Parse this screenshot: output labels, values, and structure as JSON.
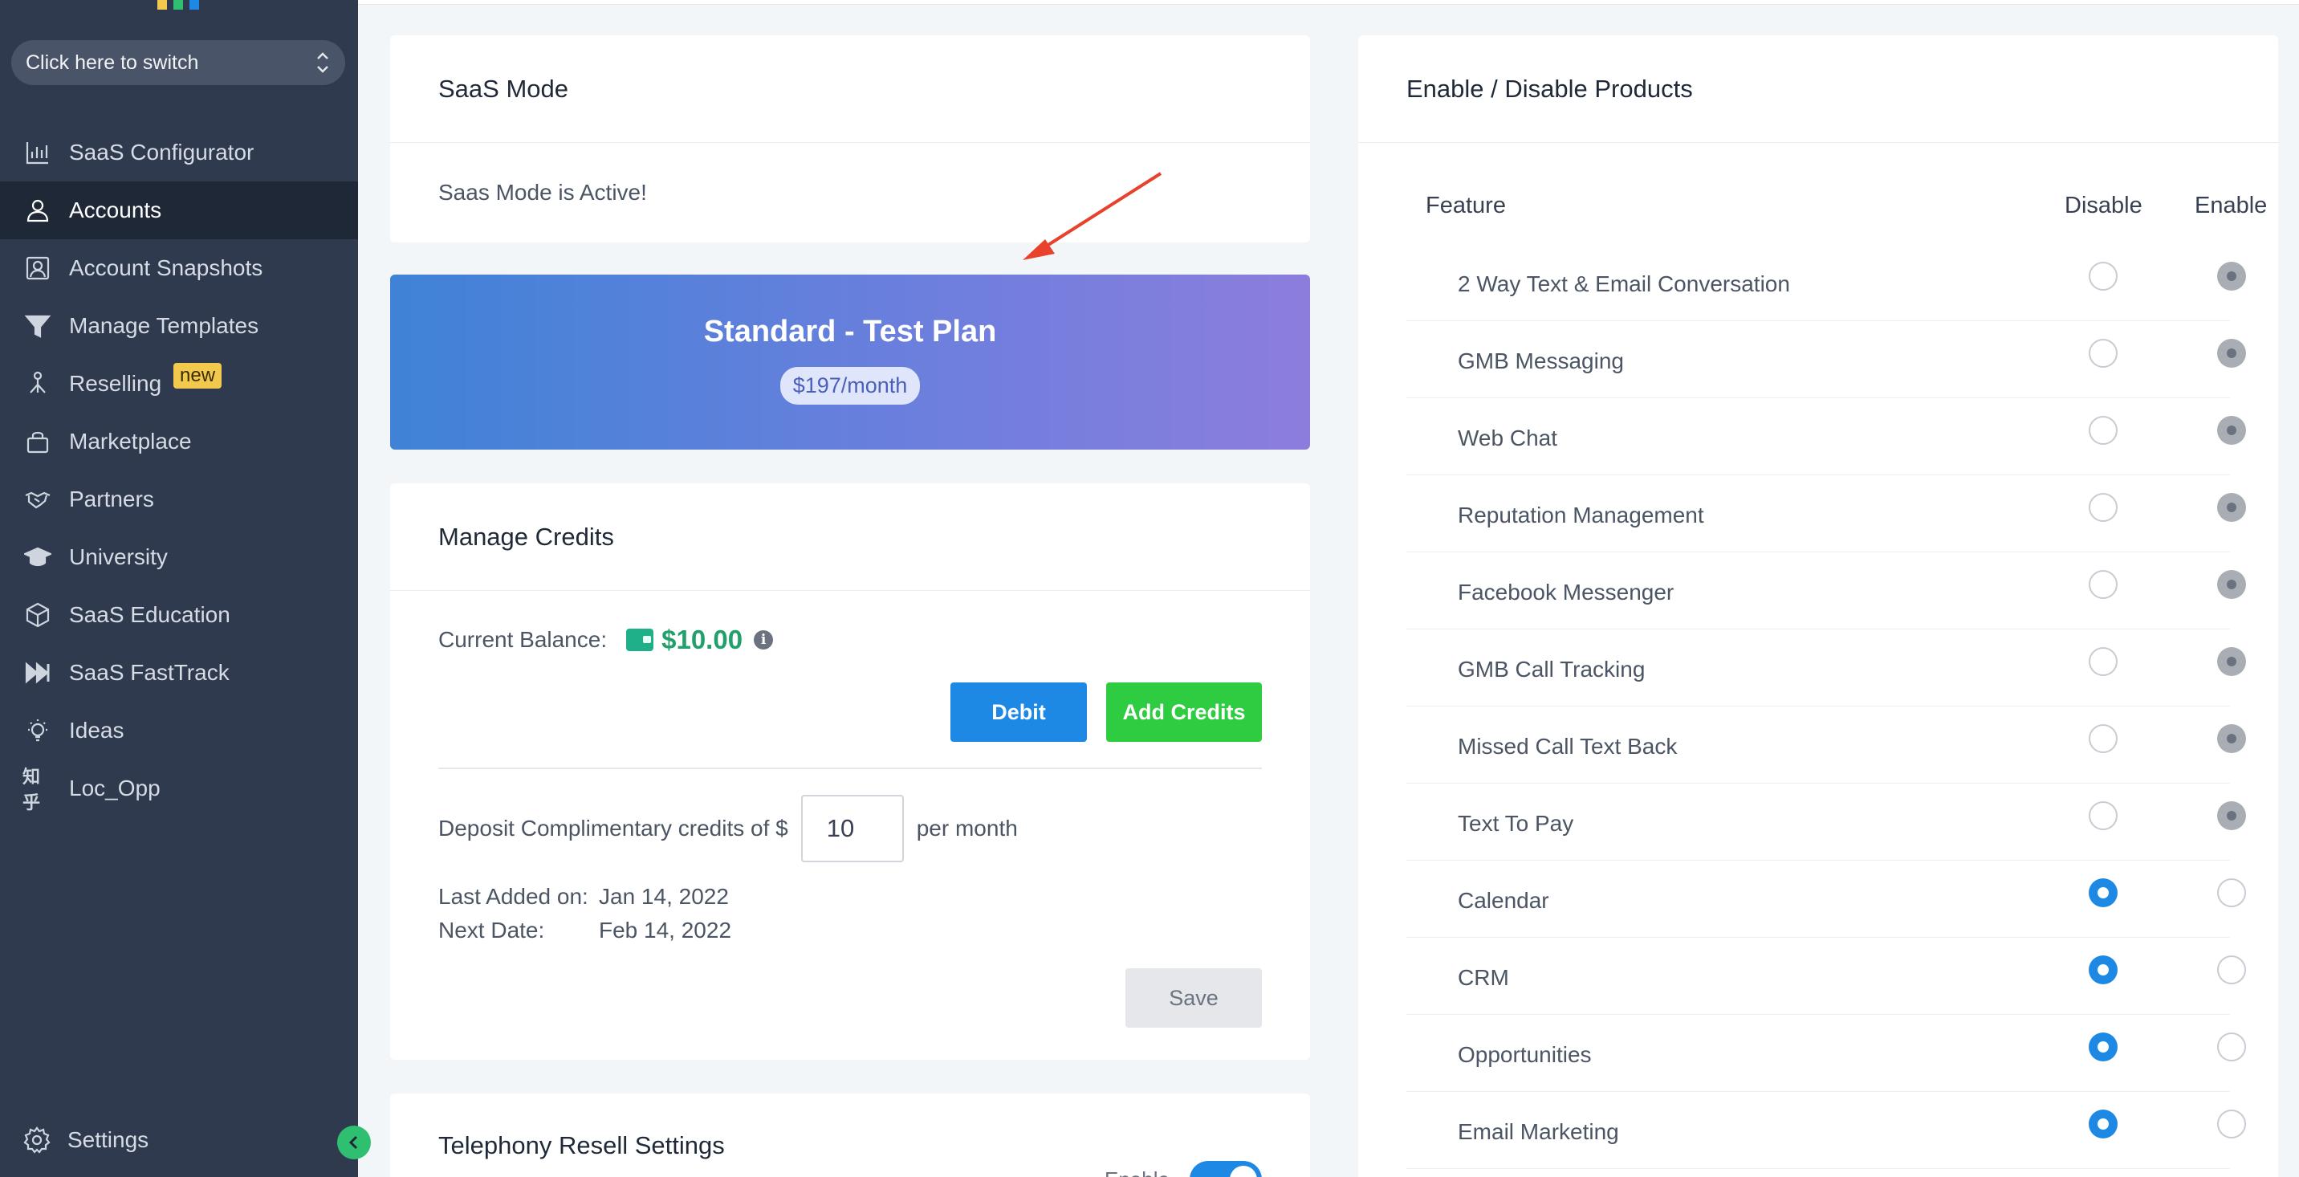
{
  "sidebar": {
    "switcher_label": "Click here to switch",
    "items": [
      {
        "label": "SaaS Configurator",
        "icon": "bar-chart-icon"
      },
      {
        "label": "Accounts",
        "icon": "user-icon",
        "active": true
      },
      {
        "label": "Account Snapshots",
        "icon": "snapshot-icon"
      },
      {
        "label": "Manage Templates",
        "icon": "filter-icon"
      },
      {
        "label": "Reselling",
        "icon": "network-icon",
        "badge": "new"
      },
      {
        "label": "Marketplace",
        "icon": "bag-icon"
      },
      {
        "label": "Partners",
        "icon": "handshake-icon"
      },
      {
        "label": "University",
        "icon": "graduation-cap-icon"
      },
      {
        "label": "SaaS Education",
        "icon": "cube-icon"
      },
      {
        "label": "SaaS FastTrack",
        "icon": "fast-forward-icon"
      },
      {
        "label": "Ideas",
        "icon": "lightbulb-icon"
      },
      {
        "label": "Loc_Opp",
        "icon": "zhihu-icon"
      }
    ],
    "settings_label": "Settings",
    "logo_colors": [
      "#f2c94c",
      "#2fbf71",
      "#1e88e5"
    ]
  },
  "saas_mode": {
    "title": "SaaS Mode",
    "status": "Saas Mode is Active!"
  },
  "plan": {
    "name": "Standard - Test Plan",
    "price": "$197/month"
  },
  "credits": {
    "title": "Manage Credits",
    "balance_label": "Current Balance:",
    "balance_value": "$10.00",
    "debit_label": "Debit",
    "add_label": "Add Credits",
    "deposit_prefix": "Deposit Complimentary credits of $",
    "deposit_value": "10",
    "deposit_suffix": "per month",
    "last_added_label": "Last Added on:",
    "last_added_value": "Jan 14, 2022",
    "next_date_label": "Next Date:",
    "next_date_value": "Feb 14, 2022",
    "save_label": "Save"
  },
  "telephony": {
    "title": "Telephony Resell Settings",
    "enable_label": "Enable",
    "enabled": true
  },
  "products": {
    "title": "Enable / Disable Products",
    "col_feature": "Feature",
    "col_disable": "Disable",
    "col_enable": "Enable",
    "rows": [
      {
        "name": "2 Way Text & Email Conversation",
        "state": "enable-locked"
      },
      {
        "name": "GMB Messaging",
        "state": "enable-locked"
      },
      {
        "name": "Web Chat",
        "state": "enable-locked"
      },
      {
        "name": "Reputation Management",
        "state": "enable-locked"
      },
      {
        "name": "Facebook Messenger",
        "state": "enable-locked"
      },
      {
        "name": "GMB Call Tracking",
        "state": "enable-locked"
      },
      {
        "name": "Missed Call Text Back",
        "state": "enable-locked"
      },
      {
        "name": "Text To Pay",
        "state": "enable-locked"
      },
      {
        "name": "Calendar",
        "state": "disable"
      },
      {
        "name": "CRM",
        "state": "disable"
      },
      {
        "name": "Opportunities",
        "state": "disable"
      },
      {
        "name": "Email Marketing",
        "state": "disable"
      }
    ]
  },
  "colors": {
    "sidebar_bg": "#2f3a4e",
    "active_bg": "#1f2837",
    "primary": "#1e88e5",
    "success": "#2ecc40",
    "balance": "#22a06b",
    "annotation_arrow": "#e8412c"
  }
}
